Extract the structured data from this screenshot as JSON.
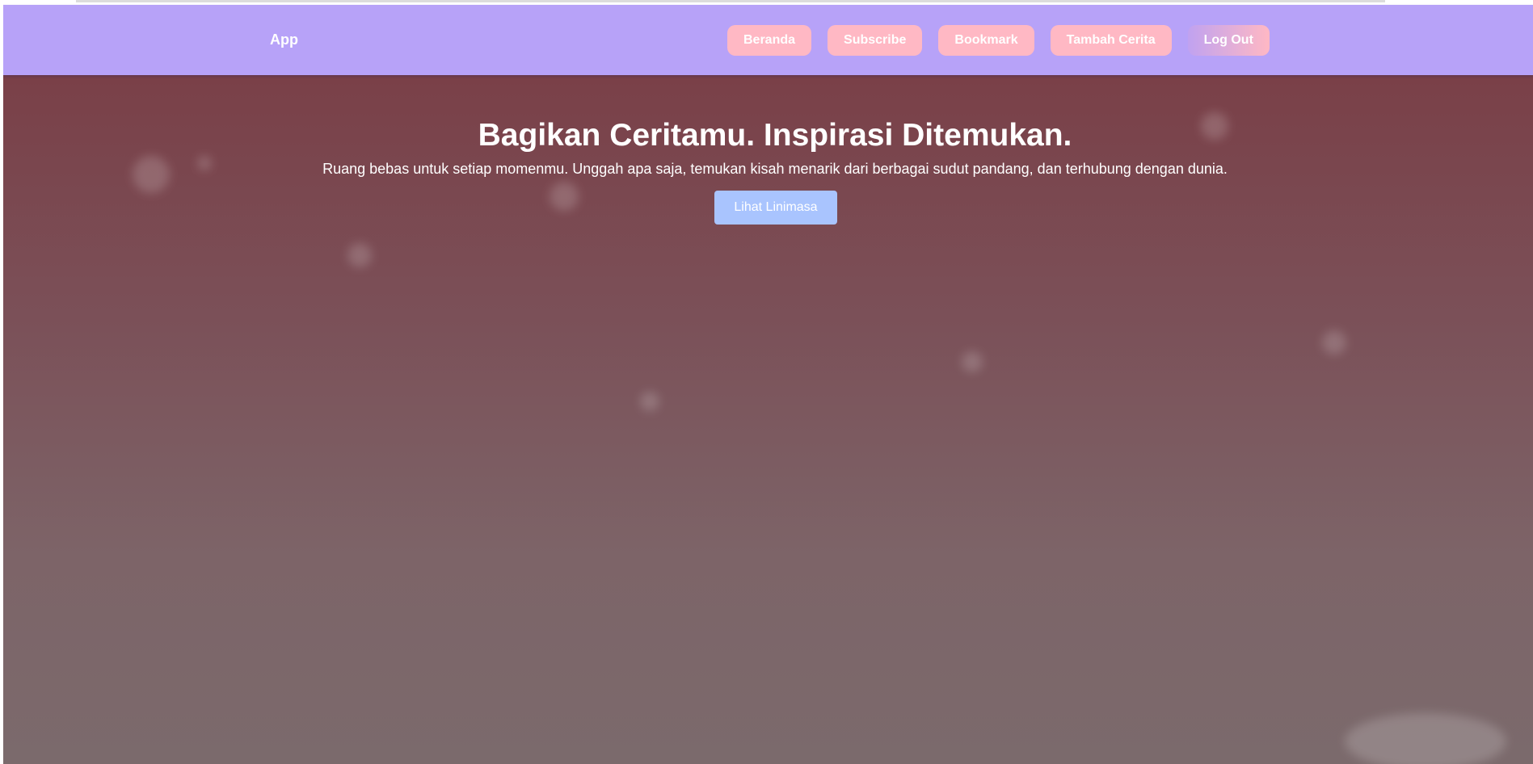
{
  "navbar": {
    "brand": "App",
    "links": [
      {
        "label": "Beranda"
      },
      {
        "label": "Subscribe"
      },
      {
        "label": "Bookmark"
      },
      {
        "label": "Tambah Cerita"
      },
      {
        "label": "Log Out"
      }
    ]
  },
  "hero": {
    "title": "Bagikan Ceritamu. Inspirasi Ditemukan.",
    "subtitle": "Ruang bebas untuk setiap momenmu. Unggah apa saja, temukan kisah menarik dari berbagai sudut pandang, dan terhubung dengan dunia.",
    "cta_label": "Lihat Linimasa"
  },
  "colors": {
    "navbar_bg": "#b7a2f8",
    "nav_button_bg": "#ffb8c4",
    "cta_bg": "#a9c4fe",
    "hero_overlay": "#7a4d55"
  }
}
